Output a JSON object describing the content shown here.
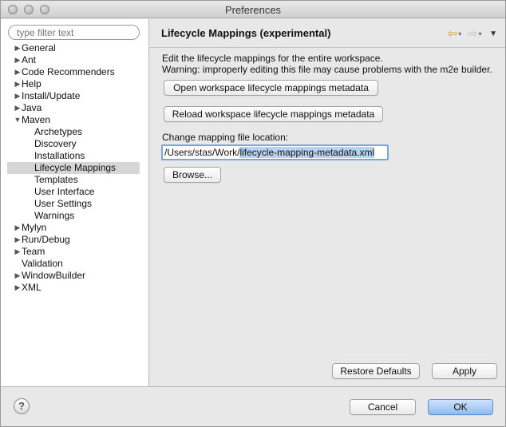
{
  "window": {
    "title": "Preferences"
  },
  "sidebar": {
    "filter_placeholder": "type filter text",
    "items": [
      {
        "label": "General",
        "expandable": true
      },
      {
        "label": "Ant",
        "expandable": true
      },
      {
        "label": "Code Recommenders",
        "expandable": true
      },
      {
        "label": "Help",
        "expandable": true
      },
      {
        "label": "Install/Update",
        "expandable": true
      },
      {
        "label": "Java",
        "expandable": true
      },
      {
        "label": "Maven",
        "expanded": true
      },
      {
        "label": "Archetypes",
        "child": true
      },
      {
        "label": "Discovery",
        "child": true
      },
      {
        "label": "Installations",
        "child": true
      },
      {
        "label": "Lifecycle Mappings",
        "child": true,
        "selected": true
      },
      {
        "label": "Templates",
        "child": true
      },
      {
        "label": "User Interface",
        "child": true
      },
      {
        "label": "User Settings",
        "child": true
      },
      {
        "label": "Warnings",
        "child": true
      },
      {
        "label": "Mylyn",
        "expandable": true
      },
      {
        "label": "Run/Debug",
        "expandable": true
      },
      {
        "label": "Team",
        "expandable": true
      },
      {
        "label": "Validation",
        "expandable": false
      },
      {
        "label": "WindowBuilder",
        "expandable": true
      },
      {
        "label": "XML",
        "expandable": true
      }
    ]
  },
  "page": {
    "title": "Lifecycle Mappings (experimental)",
    "description_line1": "Edit the lifecycle mappings for the entire workspace.",
    "description_line2": "Warning: improperly editing this file may cause problems with the m2e builder.",
    "open_button": "Open workspace lifecycle mappings metadata",
    "reload_button": "Reload workspace lifecycle mappings metadata",
    "change_label": "Change mapping file location:",
    "path_prefix": "/Users/stas/Work/",
    "path_selected": "lifecycle-mapping-metadata.xml",
    "browse_button": "Browse...",
    "restore_defaults_button": "Restore Defaults",
    "apply_button": "Apply"
  },
  "footer": {
    "help_symbol": "?",
    "cancel_button": "Cancel",
    "ok_button": "OK"
  },
  "colors": {
    "selection": "#b5d3f5",
    "sidebar_selected": "#d6d6d6",
    "focus_ring": "#7ba6dc"
  }
}
